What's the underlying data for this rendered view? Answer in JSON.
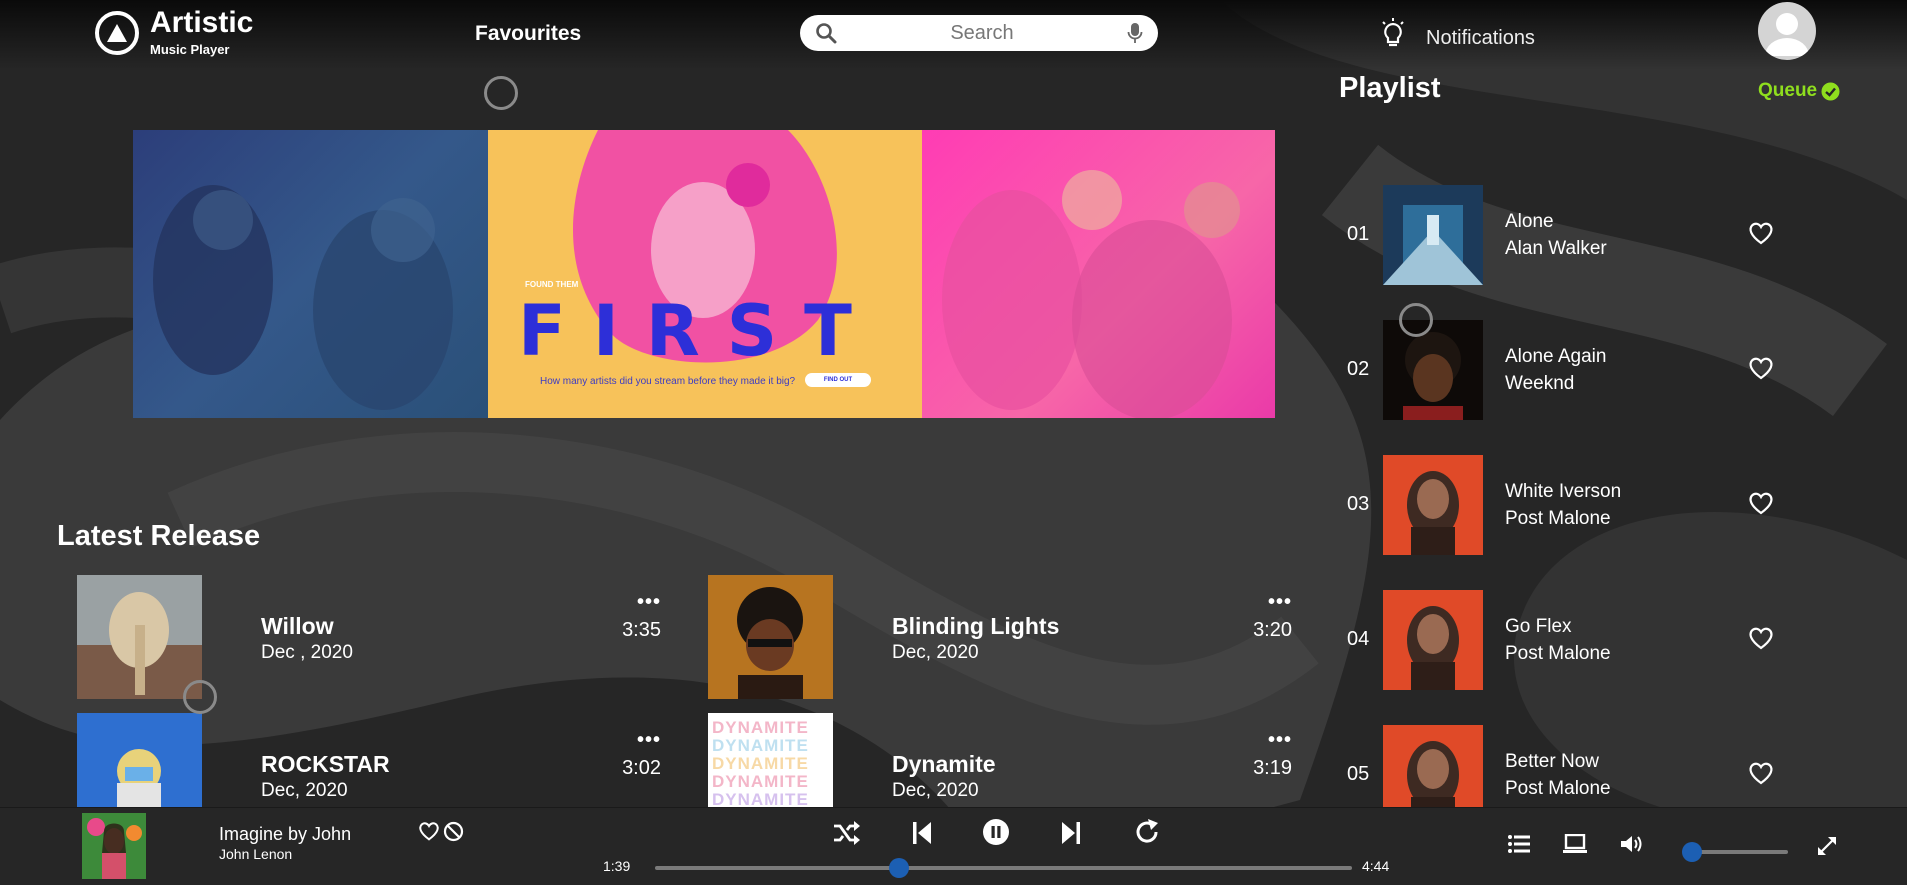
{
  "app": {
    "title": "Artistic",
    "subtitle": "Music Player"
  },
  "nav": {
    "favourites": "Favourites",
    "notifications": "Notifications"
  },
  "search": {
    "placeholder": "Search"
  },
  "banner": {
    "kicker": "FOUND THEM",
    "headline": "FIRST",
    "question": "How many artists did you stream before they made it big?",
    "cta": "FIND OUT"
  },
  "latest": {
    "title": "Latest Release",
    "items": [
      {
        "title": "Willow",
        "date": "Dec , 2020",
        "duration": "3:35",
        "more": "•••"
      },
      {
        "title": "Blinding Lights",
        "date": "Dec, 2020",
        "duration": "3:20",
        "more": "•••"
      },
      {
        "title": "ROCKSTAR",
        "date": "Dec, 2020",
        "duration": "3:02",
        "more": "•••"
      },
      {
        "title": "Dynamite",
        "date": "Dec, 2020",
        "duration": "3:19",
        "more": "•••"
      }
    ],
    "dynamite_cover_text": "DYNAMITE"
  },
  "playlist": {
    "title": "Playlist",
    "queue_label": "Queue",
    "items": [
      {
        "num": "01",
        "song": "Alone",
        "artist": "Alan Walker"
      },
      {
        "num": "02",
        "song": "Alone Again",
        "artist": "Weeknd"
      },
      {
        "num": "03",
        "song": "White Iverson",
        "artist": "Post Malone"
      },
      {
        "num": "04",
        "song": "Go Flex",
        "artist": "Post Malone"
      },
      {
        "num": "05",
        "song": "Better Now",
        "artist": "Post Malone"
      }
    ]
  },
  "player": {
    "song": "Imagine by John",
    "artist": "John Lenon",
    "elapsed": "1:39",
    "total": "4:44",
    "progress_fraction": 0.35,
    "volume_fraction": 0.0
  },
  "colors": {
    "accent": "#1c5fb3",
    "queue": "#8fde1e",
    "background": "#262626"
  },
  "icons": [
    "logo-triangle-icon",
    "search-icon",
    "mic-icon",
    "lightbulb-icon",
    "user-avatar-icon",
    "check-circle-icon",
    "heart-icon",
    "block-icon",
    "shuffle-icon",
    "previous-icon",
    "pause-icon",
    "next-icon",
    "repeat-icon",
    "queue-list-icon",
    "device-icon",
    "volume-icon",
    "fullscreen-icon"
  ]
}
